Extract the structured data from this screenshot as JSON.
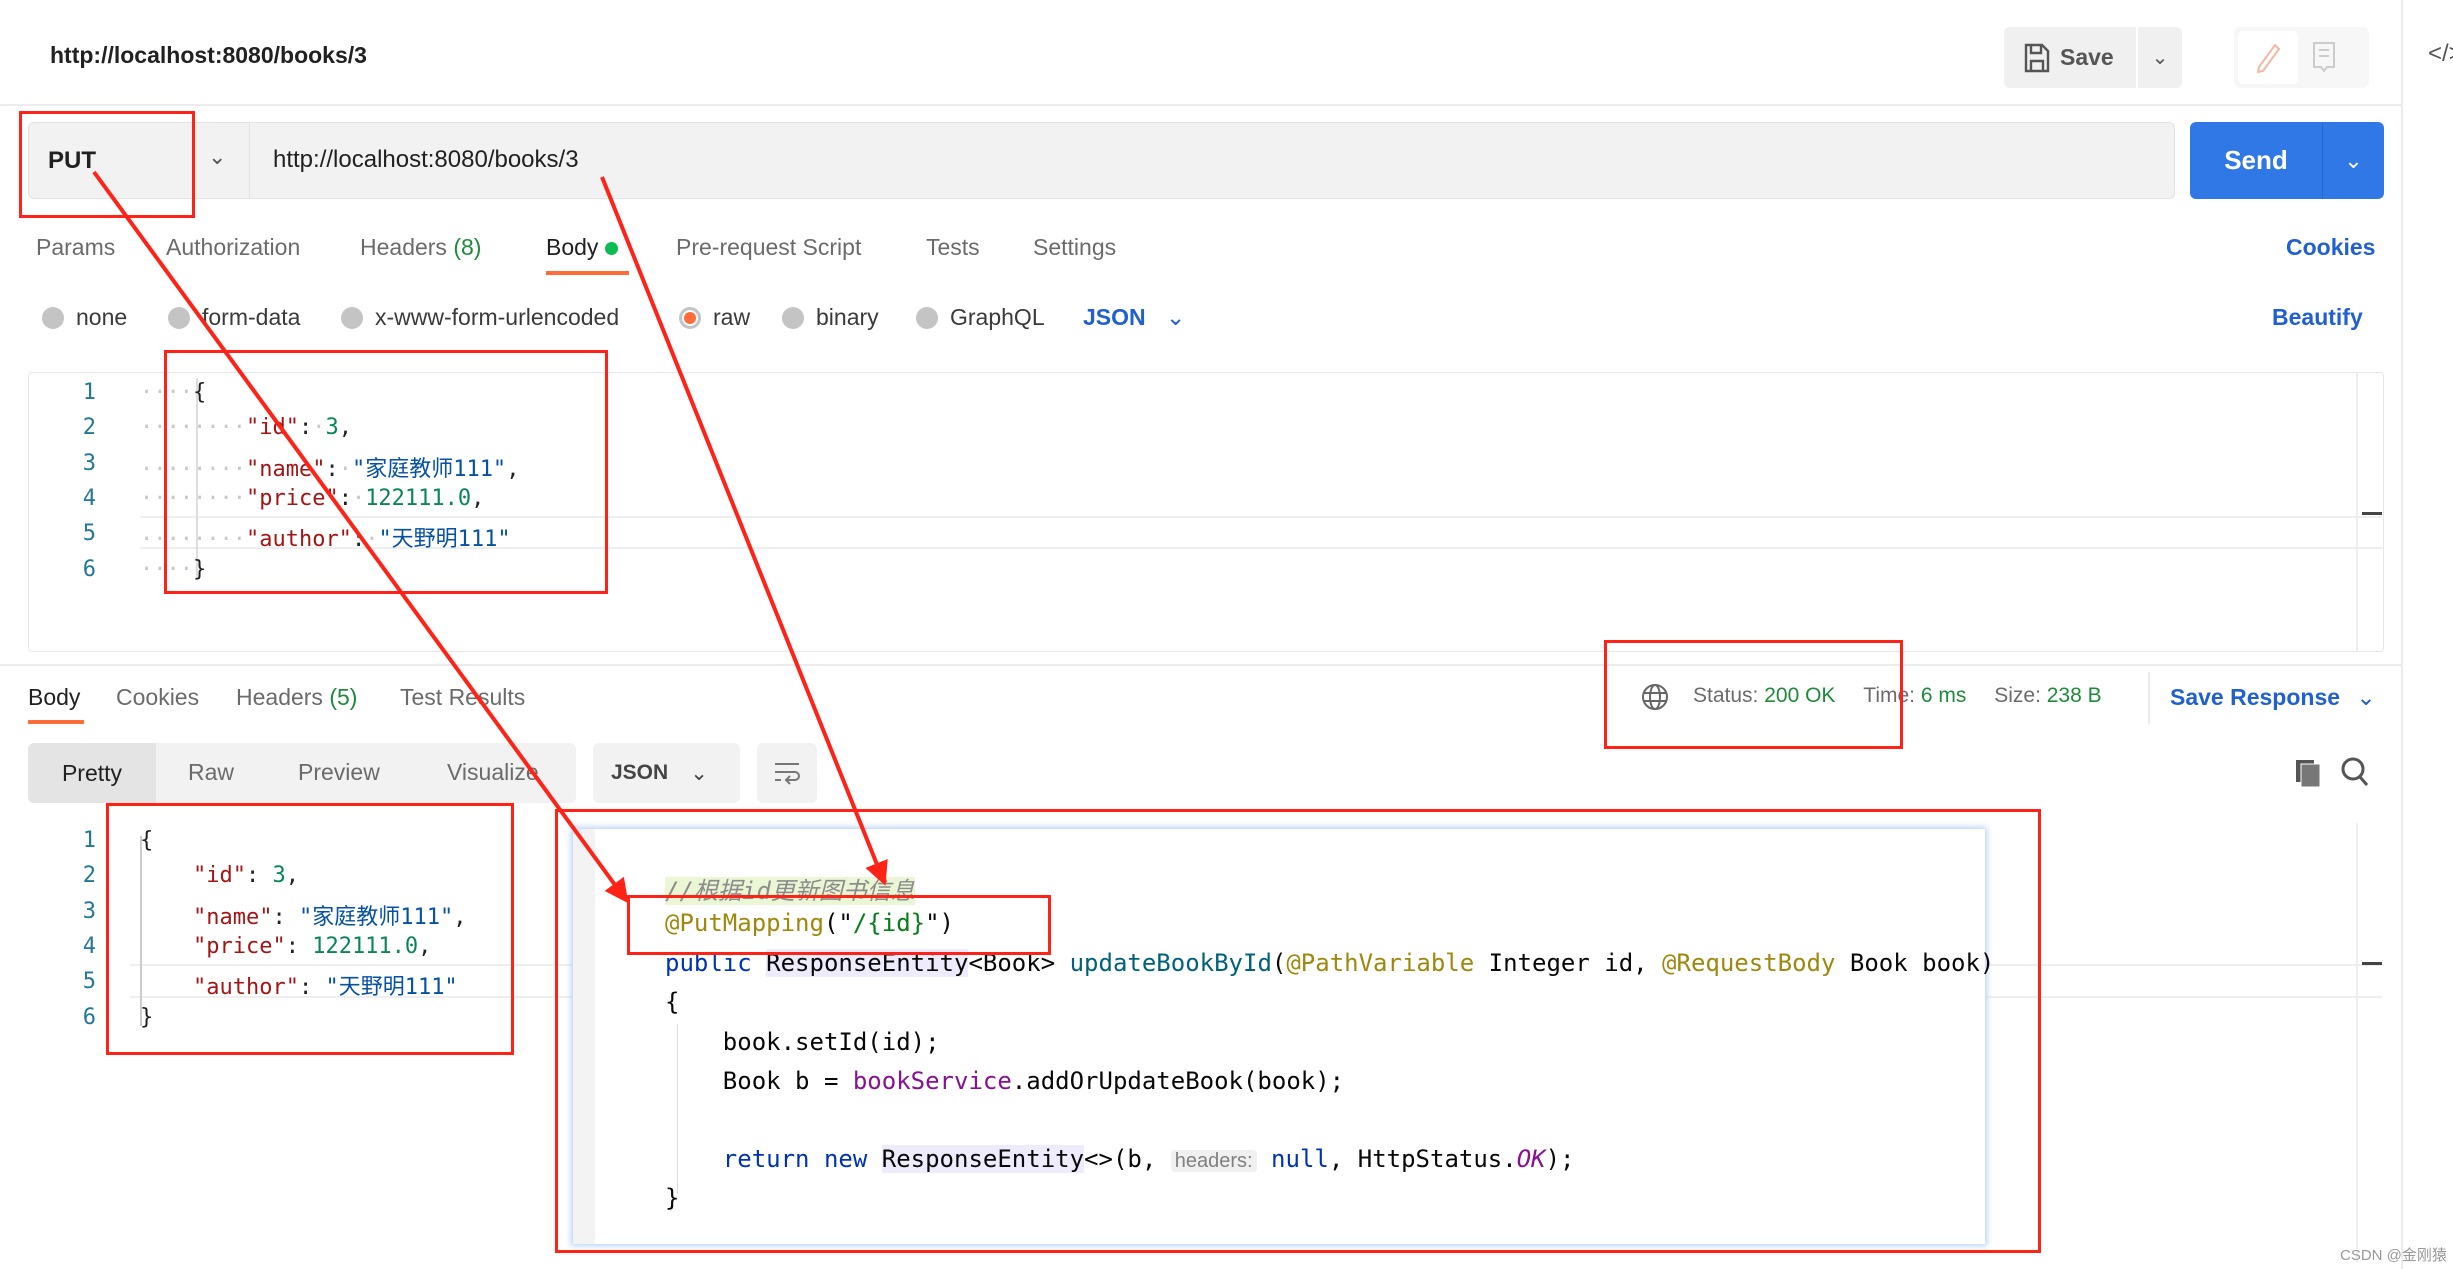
{
  "header": {
    "title": "http://localhost:8080/books/3",
    "save_label": "Save",
    "code_label": "</>"
  },
  "request": {
    "method": "PUT",
    "url": "http://localhost:8080/books/3",
    "send_label": "Send",
    "tabs": [
      {
        "label": "Params"
      },
      {
        "label": "Authorization"
      },
      {
        "label": "Headers",
        "count": "(8)"
      },
      {
        "label": "Body",
        "active": true
      },
      {
        "label": "Pre-request Script"
      },
      {
        "label": "Tests"
      },
      {
        "label": "Settings"
      }
    ],
    "cookies_label": "Cookies",
    "body_types": [
      {
        "label": "none"
      },
      {
        "label": "form-data"
      },
      {
        "label": "x-www-form-urlencoded"
      },
      {
        "label": "raw",
        "selected": true
      },
      {
        "label": "binary"
      },
      {
        "label": "GraphQL"
      }
    ],
    "format": "JSON",
    "beautify_label": "Beautify",
    "body_lines": [
      [
        {
          "t": "····",
          "k": "ws"
        },
        {
          "t": "{",
          "k": "p"
        }
      ],
      [
        {
          "t": "········",
          "k": "ws"
        },
        {
          "t": "\"id\"",
          "k": "k"
        },
        {
          "t": ":",
          "k": "p"
        },
        {
          "t": "·",
          "k": "ws"
        },
        {
          "t": "3",
          "k": "n"
        },
        {
          "t": ",",
          "k": "p"
        }
      ],
      [
        {
          "t": "········",
          "k": "ws"
        },
        {
          "t": "\"name\"",
          "k": "k"
        },
        {
          "t": ":",
          "k": "p"
        },
        {
          "t": "·",
          "k": "ws"
        },
        {
          "t": "\"家庭教师111\"",
          "k": "s"
        },
        {
          "t": ",",
          "k": "p"
        }
      ],
      [
        {
          "t": "········",
          "k": "ws"
        },
        {
          "t": "\"price\"",
          "k": "k"
        },
        {
          "t": ":",
          "k": "p"
        },
        {
          "t": "·",
          "k": "ws"
        },
        {
          "t": "122111.0",
          "k": "n"
        },
        {
          "t": ",",
          "k": "p"
        }
      ],
      [
        {
          "t": "········",
          "k": "ws"
        },
        {
          "t": "\"author\"",
          "k": "k"
        },
        {
          "t": ":",
          "k": "p"
        },
        {
          "t": "·",
          "k": "ws"
        },
        {
          "t": "\"天野明111\"",
          "k": "s"
        }
      ],
      [
        {
          "t": "····",
          "k": "ws"
        },
        {
          "t": "}",
          "k": "p"
        }
      ]
    ]
  },
  "response": {
    "tabs": [
      {
        "label": "Body",
        "active": true
      },
      {
        "label": "Cookies"
      },
      {
        "label": "Headers",
        "count": "(5)"
      },
      {
        "label": "Test Results"
      }
    ],
    "status_label": "Status:",
    "status": "200 OK",
    "time_label": "Time:",
    "time": "6 ms",
    "size_label": "Size:",
    "size": "238 B",
    "save_response_label": "Save Response",
    "views": [
      "Pretty",
      "Raw",
      "Preview",
      "Visualize"
    ],
    "format": "JSON",
    "body_lines": [
      [
        {
          "t": "{",
          "k": "p"
        }
      ],
      [
        {
          "t": "    ",
          "k": "p"
        },
        {
          "t": "\"id\"",
          "k": "k"
        },
        {
          "t": ": ",
          "k": "p"
        },
        {
          "t": "3",
          "k": "n"
        },
        {
          "t": ",",
          "k": "p"
        }
      ],
      [
        {
          "t": "    ",
          "k": "p"
        },
        {
          "t": "\"name\"",
          "k": "k"
        },
        {
          "t": ": ",
          "k": "p"
        },
        {
          "t": "\"家庭教师111\"",
          "k": "s"
        },
        {
          "t": ",",
          "k": "p"
        }
      ],
      [
        {
          "t": "    ",
          "k": "p"
        },
        {
          "t": "\"price\"",
          "k": "k"
        },
        {
          "t": ": ",
          "k": "p"
        },
        {
          "t": "122111.0",
          "k": "n"
        },
        {
          "t": ",",
          "k": "p"
        }
      ],
      [
        {
          "t": "    ",
          "k": "p"
        },
        {
          "t": "\"author\"",
          "k": "k"
        },
        {
          "t": ": ",
          "k": "p"
        },
        {
          "t": "\"天野明111\"",
          "k": "s"
        }
      ],
      [
        {
          "t": "}",
          "k": "p"
        }
      ]
    ]
  },
  "java_code": [
    [
      {
        "t": "//根据id更新图书信息",
        "k": "comment"
      }
    ],
    [
      {
        "t": "@PutMapping",
        "k": "anno"
      },
      {
        "t": "(\"",
        "k": "p"
      },
      {
        "t": "/{id}",
        "k": "str"
      },
      {
        "t": "\")",
        "k": "p"
      }
    ],
    [
      {
        "t": "public",
        "k": "kw"
      },
      {
        "t": " ",
        "k": "p"
      },
      {
        "t": "ResponseEntity",
        "k": "hl"
      },
      {
        "t": "<Book> ",
        "k": "p"
      },
      {
        "t": "updateBookById",
        "k": "fn"
      },
      {
        "t": "(",
        "k": "p"
      },
      {
        "t": "@PathVariable",
        "k": "anno"
      },
      {
        "t": " Integer id, ",
        "k": "p"
      },
      {
        "t": "@RequestBody",
        "k": "anno"
      },
      {
        "t": " Book book)",
        "k": "p"
      }
    ],
    [
      {
        "t": "{",
        "k": "p"
      }
    ],
    [
      {
        "t": "    book.setId(id);",
        "k": "p"
      }
    ],
    [
      {
        "t": "    Book b = ",
        "k": "p"
      },
      {
        "t": "bookService",
        "k": "field"
      },
      {
        "t": ".addOrUpdateBook(book);",
        "k": "p"
      }
    ],
    [],
    [
      {
        "t": "    ",
        "k": "p"
      },
      {
        "t": "return new",
        "k": "kw"
      },
      {
        "t": " ",
        "k": "p"
      },
      {
        "t": "ResponseEntity",
        "k": "hl"
      },
      {
        "t": "<>(b, ",
        "k": "p"
      },
      {
        "t": "headers:",
        "k": "hint"
      },
      {
        "t": " ",
        "k": "p"
      },
      {
        "t": "null",
        "k": "kw"
      },
      {
        "t": ", HttpStatus.",
        "k": "p"
      },
      {
        "t": "OK",
        "k": "const"
      },
      {
        "t": ");",
        "k": "p"
      }
    ],
    [
      {
        "t": "}",
        "k": "p"
      }
    ]
  ],
  "watermark": "CSDN @金刚猿",
  "colors": {
    "accent": "#ff6c37",
    "send": "#3078e6",
    "link": "#2160d0",
    "success": "#1f8a3a",
    "annotation_box": "#ff2216"
  }
}
